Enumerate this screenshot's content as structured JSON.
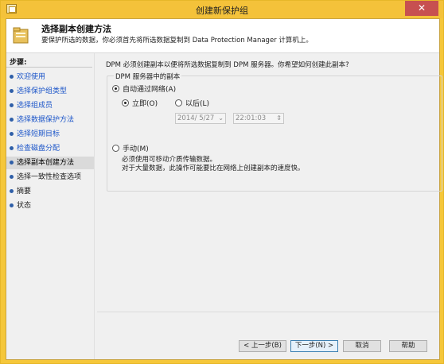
{
  "window": {
    "title": "创建新保护组",
    "close_glyph": "✕"
  },
  "header": {
    "heading": "选择副本创建方法",
    "subheading": "要保护所选的数据，你必须首先将所选数据复制到 Data Protection Manager 计算机上。"
  },
  "sidebar": {
    "title": "步骤:",
    "steps": [
      {
        "label": "欢迎使用"
      },
      {
        "label": "选择保护组类型"
      },
      {
        "label": "选择组成员"
      },
      {
        "label": "选择数据保护方法"
      },
      {
        "label": "选择短期目标"
      },
      {
        "label": "检查磁盘分配"
      },
      {
        "label": "选择副本创建方法"
      },
      {
        "label": "选择一致性检查选项"
      },
      {
        "label": "摘要"
      },
      {
        "label": "状态"
      }
    ]
  },
  "main": {
    "question": "DPM 必须创建副本以便将所选数据复制到 DPM 服务器。你希望如何创建此副本?",
    "group_legend": "DPM 服务器中的副本",
    "auto_label": "自动通过网络(A)",
    "now_label": "立即(O)",
    "later_label": "以后(L)",
    "date_value": "2014/ 5/27",
    "time_value": "22:01:03",
    "manual_label": "手动(M)",
    "manual_desc_1": "必须使用可移动介质传输数据。",
    "manual_desc_2": "对于大量数据，此操作可能要比在网络上创建副本的速度快。"
  },
  "footer": {
    "back": "< 上一步(B)",
    "next": "下一步(N) >",
    "cancel": "取消",
    "help": "帮助"
  }
}
